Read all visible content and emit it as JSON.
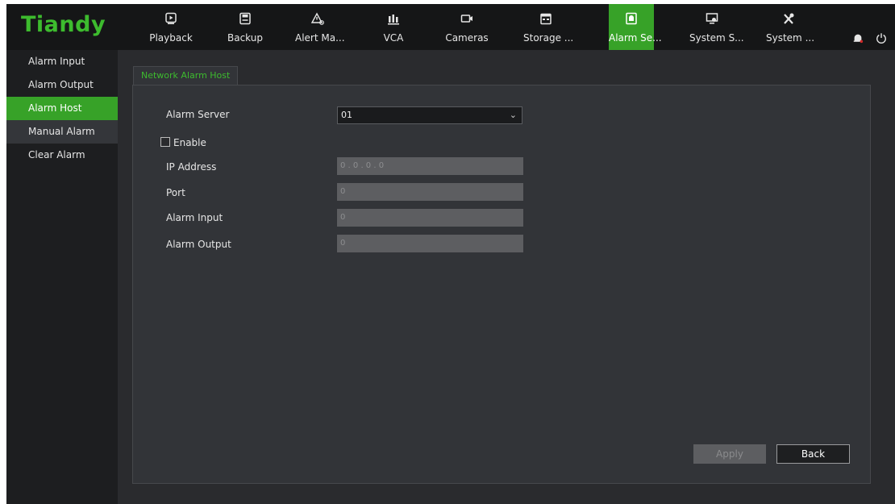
{
  "app": {
    "logo": "Tiandy"
  },
  "nav": [
    {
      "label": "Playback",
      "icon": "playback-icon"
    },
    {
      "label": "Backup",
      "icon": "backup-icon"
    },
    {
      "label": "Alert Ma...",
      "icon": "alert-icon"
    },
    {
      "label": "VCA",
      "icon": "vca-icon"
    },
    {
      "label": "Cameras",
      "icon": "camera-icon"
    },
    {
      "label": "Storage ...",
      "icon": "storage-icon"
    },
    {
      "label": "Alarm Se...",
      "icon": "alarm-settings-icon",
      "active": true
    },
    {
      "label": "System S...",
      "icon": "system-settings-icon"
    },
    {
      "label": "System ...",
      "icon": "system-tools-icon"
    }
  ],
  "top_icons": [
    "bell-icon",
    "power-icon"
  ],
  "sidebar": {
    "items": [
      {
        "label": "Alarm Input"
      },
      {
        "label": "Alarm Output"
      },
      {
        "label": "Alarm Host",
        "active": true
      },
      {
        "label": "Manual Alarm"
      },
      {
        "label": "Clear Alarm"
      }
    ]
  },
  "tab": {
    "label": "Network Alarm Host"
  },
  "form": {
    "alarm_server_label": "Alarm Server",
    "alarm_server_value": "01",
    "enable_label": "Enable",
    "enable_checked": false,
    "ip_label": "IP Address",
    "ip_value": "0 . 0 . 0 . 0",
    "port_label": "Port",
    "port_value": "0",
    "alarm_input_label": "Alarm Input",
    "alarm_input_value": "0",
    "alarm_output_label": "Alarm Output",
    "alarm_output_value": "0"
  },
  "buttons": {
    "apply": "Apply",
    "back": "Back"
  },
  "colors": {
    "accent": "#37a228",
    "logo": "#3dbb2e"
  }
}
